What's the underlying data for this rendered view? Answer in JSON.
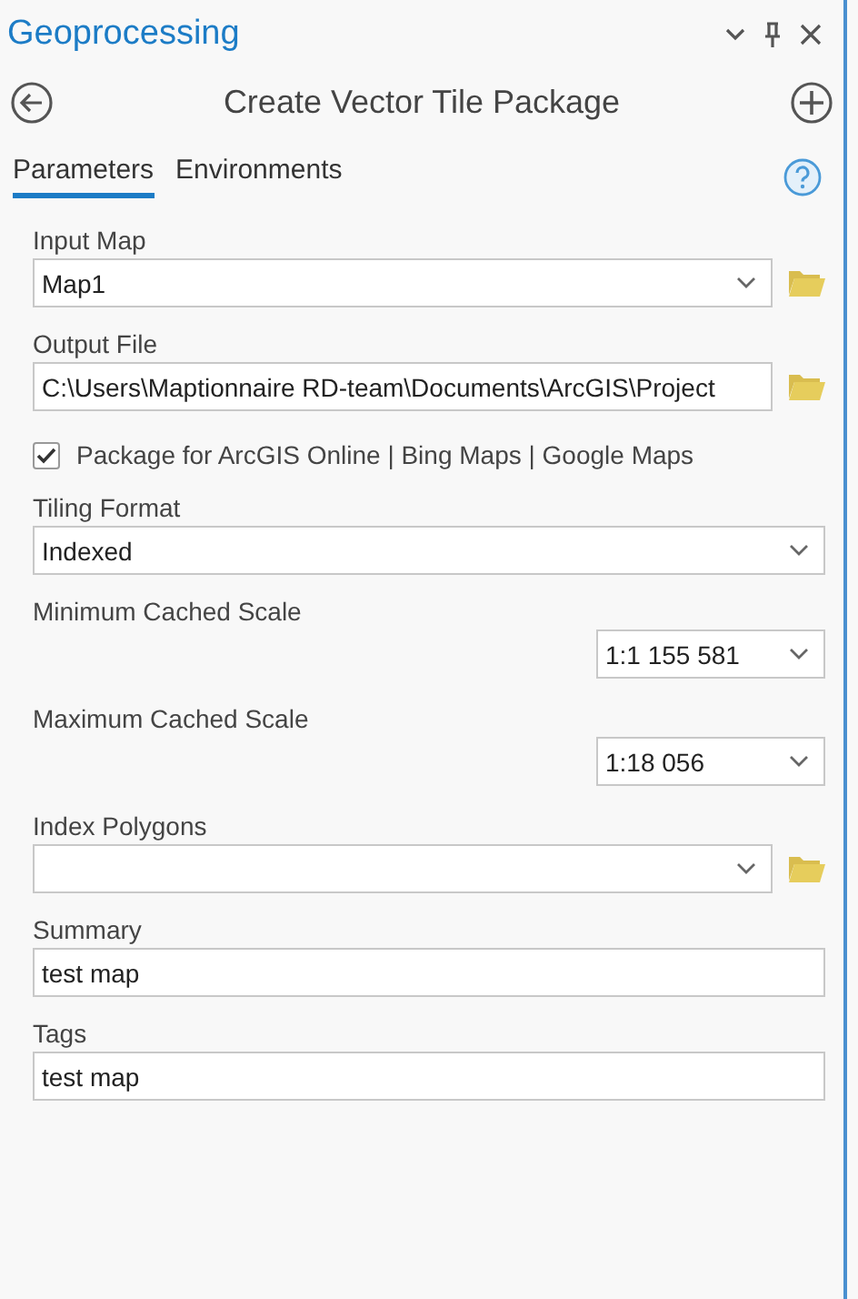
{
  "pane": {
    "title": "Geoprocessing"
  },
  "tool": {
    "title": "Create Vector Tile Package"
  },
  "tabs": [
    {
      "label": "Parameters",
      "selected": true
    },
    {
      "label": "Environments",
      "selected": false
    }
  ],
  "parameters": [
    {
      "kind": "dropdown",
      "label": "Input Map",
      "value": "Map1",
      "browse": true
    },
    {
      "kind": "text",
      "label": "Output File",
      "value": "C:\\Users\\Maptionnaire RD-team\\Documents\\ArcGIS\\Project",
      "browse": true
    },
    {
      "kind": "checkbox",
      "label": "Package for ArcGIS Online | Bing Maps | Google Maps",
      "checked": true
    },
    {
      "kind": "dropdown",
      "label": "Tiling Format",
      "value": "Indexed",
      "browse": false
    },
    {
      "kind": "scale",
      "label": "Minimum Cached Scale",
      "value": "1:1 155 581"
    },
    {
      "kind": "scale",
      "label": "Maximum Cached Scale",
      "value": "1:18 056"
    },
    {
      "kind": "dropdown",
      "label": "Index Polygons",
      "browse": true
    },
    {
      "kind": "text",
      "label": "Summary",
      "value": "test map",
      "browse": false
    },
    {
      "kind": "text",
      "label": "Tags",
      "value": "test map",
      "browse": false
    }
  ]
}
